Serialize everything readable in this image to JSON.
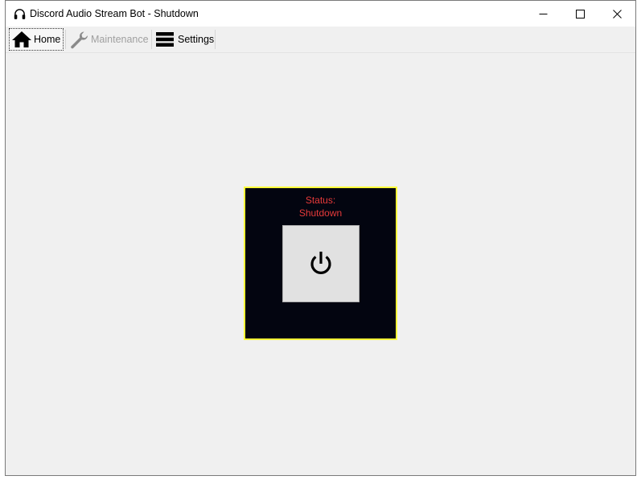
{
  "window": {
    "title": "Discord Audio Stream Bot - Shutdown",
    "title_icon": "headphones-icon"
  },
  "caption_buttons": {
    "minimize_icon": "minimize-icon",
    "maximize_icon": "maximize-icon",
    "close_icon": "close-icon"
  },
  "toolbar": {
    "home_label": "Home",
    "home_icon": "home-icon",
    "maintenance_label": "Maintenance",
    "maintenance_icon": "wrench-icon",
    "maintenance_enabled": false,
    "settings_label": "Settings",
    "settings_icon": "menu-icon"
  },
  "status": {
    "label": "Status:",
    "value": "Shutdown",
    "text_color": "#e83a3a",
    "panel_background": "#030510",
    "panel_border": "#ffff38",
    "power_icon": "power-icon"
  }
}
